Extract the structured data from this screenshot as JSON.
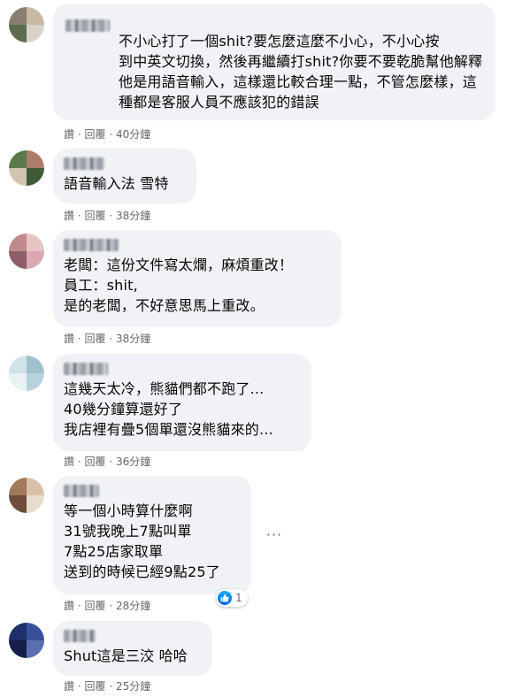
{
  "actions": {
    "like": "讚",
    "reply": "回覆",
    "separator": "·"
  },
  "comments": [
    {
      "text": "不小心打了一個shit?要怎麼這麼不小心，不小心按\n到中英文切換，然後再繼續打shit?你要不要乾脆幫他解釋\n他是用語音輸入，這樣還比較合理一點，不管怎麼樣，這\n種都是客服人員不應該犯的錯誤",
      "time": "40分鐘",
      "avatar_colors": [
        "#8a7f6e",
        "#c9b8a2",
        "#5d6b4f",
        "#d8d2c8"
      ]
    },
    {
      "text": "語音輸入法 雪特",
      "time": "38分鐘",
      "avatar_colors": [
        "#5a7a4c",
        "#b07a6a",
        "#d4c3b0",
        "#3f5a38"
      ]
    },
    {
      "text": "老闆：這份文件寫太爛，麻煩重改！\n員工：shit,\n是的老闆，不好意思馬上重改。",
      "time": "38分鐘",
      "avatar_colors": [
        "#c08a8a",
        "#e6c4c4",
        "#8f5c6a",
        "#d9a8b0"
      ]
    },
    {
      "text": "這幾天太冷，熊貓們都不跑了...\n40幾分鐘算還好了\n我店裡有疊5個單還沒熊貓來的...",
      "time": "36分鐘",
      "avatar_colors": [
        "#cfe3ea",
        "#9fc1cc",
        "#e8f1f3",
        "#b6d3dc"
      ]
    },
    {
      "text": "等一個小時算什麼啊\n31號我晚上7點叫單\n7點25店家取單\n送到的時候已經9點25了",
      "time": "28分鐘",
      "reactions": "1",
      "avatar_colors": [
        "#a07a5a",
        "#d8c0a8",
        "#6e4e3a",
        "#e8dccf"
      ]
    },
    {
      "text": "Shut這是三洨 哈哈",
      "time": "25分鐘",
      "avatar_colors": [
        "#1f2f6a",
        "#3a4f9a",
        "#15204a",
        "#5a6fb0"
      ]
    }
  ]
}
